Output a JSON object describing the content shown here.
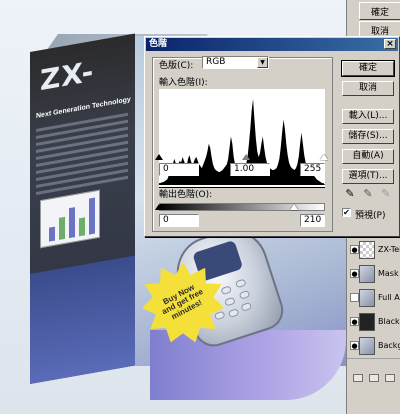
{
  "artwork": {
    "brand": "ZX-",
    "tagline": "Next Generation Technology",
    "burst_text": "Buy Now and get free minutes!",
    "colors": {
      "burst": "#f5e03a",
      "side": "#2d3140",
      "front": "#c6d4e6",
      "wave": "#9c94dc"
    }
  },
  "ps_panel": {
    "buttons": [
      "確定",
      "取消"
    ],
    "layers": [
      {
        "name": "ZX-Tel"
      },
      {
        "name": "Mask"
      },
      {
        "name": "Full Ar"
      },
      {
        "name": "Black I"
      },
      {
        "name": "Backgr"
      }
    ]
  },
  "dialog": {
    "title": "色階",
    "close_label": "×",
    "channel_label": "色版(C):",
    "channel_value": "RGB",
    "input_levels_label": "輸入色階(I):",
    "input_black": "0",
    "input_gamma": "1.00",
    "input_white": "255",
    "output_levels_label": "輸出色階(O):",
    "output_black": "0",
    "output_white": "210",
    "buttons": {
      "ok": "確定",
      "cancel": "取消",
      "load": "載入(L)...",
      "save": "儲存(S)...",
      "auto": "自動(A)",
      "options": "選項(T)..."
    },
    "preview_label": "預視(P)",
    "preview_checked": true,
    "histogram_levels": [
      2,
      2,
      3,
      3,
      4,
      5,
      6,
      10,
      14,
      18,
      22,
      28,
      24,
      20,
      22,
      26,
      24,
      30,
      26,
      22,
      20,
      28,
      32,
      26,
      22,
      24,
      28,
      30,
      26,
      22,
      20,
      18,
      22,
      26,
      30,
      36,
      44,
      40,
      30,
      22,
      18,
      16,
      15,
      14,
      14,
      15,
      16,
      18,
      20,
      22,
      28,
      40,
      52,
      44,
      30,
      22,
      18,
      16,
      15,
      14,
      15,
      16,
      18,
      22,
      30,
      44,
      60,
      80,
      92,
      70,
      50,
      36,
      30,
      34,
      44,
      52,
      40,
      30,
      24,
      20,
      18,
      17,
      16,
      16,
      17,
      18,
      22,
      28,
      40,
      56,
      70,
      60,
      44,
      32,
      24,
      20,
      18,
      17,
      16,
      18,
      22,
      30,
      44,
      56,
      44,
      32,
      24,
      20,
      18,
      16,
      14,
      12,
      10,
      8,
      6,
      5,
      4,
      3,
      2,
      2
    ]
  }
}
